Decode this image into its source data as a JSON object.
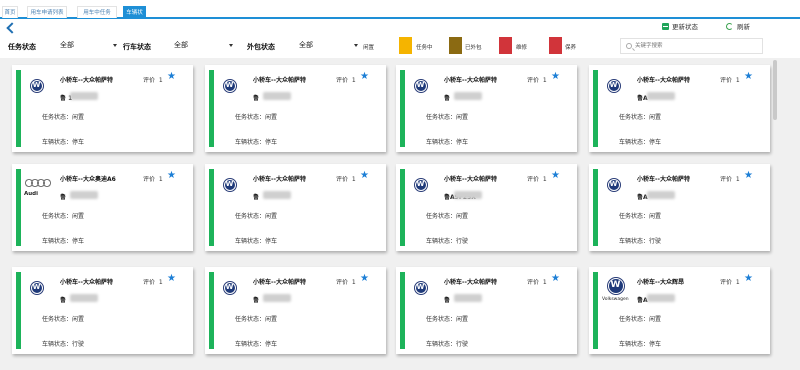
{
  "tabs": [
    {
      "label": "首页"
    },
    {
      "label": "用车申请列表"
    },
    {
      "label": "用车中任务"
    },
    {
      "label": "车辆状况"
    }
  ],
  "toolbar": {
    "update_label": "更新状态",
    "refresh_label": "刷新"
  },
  "filters": {
    "task_label": "任务状态",
    "task_value": "全部",
    "drive_label": "行车状态",
    "drive_value": "全部",
    "outsource_label": "外包状态",
    "outsource_value": "全部",
    "idle_label": "闲置"
  },
  "legend": [
    {
      "label": "任务中",
      "color": "#f5b400"
    },
    {
      "label": "已外包",
      "color": "#8b6a12"
    },
    {
      "label": "维修",
      "color": "#d1343a"
    },
    {
      "label": "保养",
      "color": "#d1343a"
    }
  ],
  "search": {
    "placeholder": "关键字搜索"
  },
  "common": {
    "rating_label": "评价",
    "task_prefix": "任务状态：",
    "vehicle_prefix": "车辆状态："
  },
  "cards": [
    {
      "logo": "vw-icon",
      "title": "小轿车--大众帕萨特",
      "rating": "1",
      "plate": "鲁          1",
      "task_status": "闲置",
      "vehicle_status": "停车",
      "status_color": "#1db35a"
    },
    {
      "logo": "vw-icon",
      "title": "小轿车--大众帕萨特",
      "rating": "1",
      "plate": "鲁",
      "task_status": "闲置",
      "vehicle_status": "停车",
      "status_color": "#1db35a"
    },
    {
      "logo": "vw-icon",
      "title": "小轿车--大众帕萨特",
      "rating": "1",
      "plate": "鲁",
      "task_status": "闲置",
      "vehicle_status": "停车",
      "status_color": "#1db35a"
    },
    {
      "logo": "vw-icon",
      "title": "小轿车--大众帕萨特",
      "rating": "1",
      "plate": "鲁A",
      "task_status": "闲置",
      "vehicle_status": "停车",
      "status_color": "#1db35a"
    },
    {
      "logo": "audi-icon",
      "brand_text": "Audi",
      "title": "小轿车--大众奥迪A6",
      "rating": "1",
      "plate": "鲁",
      "task_status": "闲置",
      "vehicle_status": "停车",
      "status_color": "#1db35a"
    },
    {
      "logo": "vw-icon",
      "title": "小轿车--大众帕萨特",
      "rating": "1",
      "plate": "鲁",
      "task_status": "闲置",
      "vehicle_status": "停车",
      "status_color": "#1db35a"
    },
    {
      "logo": "vw-icon",
      "title": "小轿车--大众帕萨特",
      "rating": "1",
      "plate": "鲁A9F25X",
      "task_status": "闲置",
      "vehicle_status": "行驶",
      "status_color": "#1db35a"
    },
    {
      "logo": "vw-icon",
      "title": "小轿车--大众帕萨特",
      "rating": "1",
      "plate": "鲁A",
      "task_status": "闲置",
      "vehicle_status": "行驶",
      "status_color": "#1db35a"
    },
    {
      "logo": "vw-icon",
      "title": "小轿车--大众帕萨特",
      "rating": "1",
      "plate": "鲁",
      "task_status": "闲置",
      "vehicle_status": "行驶",
      "status_color": "#1db35a"
    },
    {
      "logo": "vw-icon",
      "title": "小轿车--大众帕萨特",
      "rating": "1",
      "plate": "鲁",
      "task_status": "闲置",
      "vehicle_status": "停车",
      "status_color": "#1db35a"
    },
    {
      "logo": "vw-icon",
      "title": "小轿车--大众帕萨特",
      "rating": "1",
      "plate": "鲁",
      "task_status": "闲置",
      "vehicle_status": "行驶",
      "status_color": "#1db35a"
    },
    {
      "logo": "vw-icon",
      "brand_text": "Volkswagen",
      "title": "小轿车--大众辉昂",
      "rating": "1",
      "plate": "鲁A",
      "task_status": "闲置",
      "vehicle_status": "停车",
      "status_color": "#1db35a"
    }
  ]
}
